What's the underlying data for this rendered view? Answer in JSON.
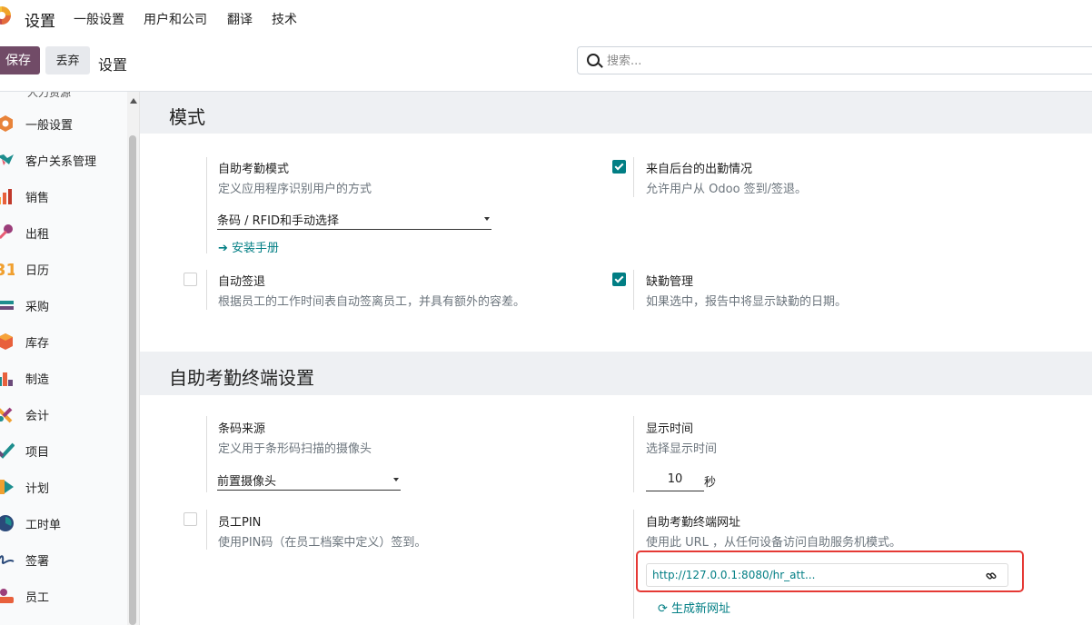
{
  "topbar": {
    "app_title": "设置",
    "menu": [
      "一般设置",
      "用户和公司",
      "翻译",
      "技术"
    ]
  },
  "toolbar": {
    "save_label": "保存",
    "discard_label": "丢弃",
    "breadcrumb": "设置",
    "search_placeholder": "搜索..."
  },
  "sidebar": {
    "cut_label": "人力资源",
    "items": [
      {
        "label": "一般设置",
        "icon": "general-settings-icon"
      },
      {
        "label": "客户关系管理",
        "icon": "crm-icon"
      },
      {
        "label": "销售",
        "icon": "sales-icon"
      },
      {
        "label": "出租",
        "icon": "rental-icon"
      },
      {
        "label": "日历",
        "icon": "calendar-icon"
      },
      {
        "label": "采购",
        "icon": "purchase-icon"
      },
      {
        "label": "库存",
        "icon": "inventory-icon"
      },
      {
        "label": "制造",
        "icon": "manufacturing-icon"
      },
      {
        "label": "会计",
        "icon": "accounting-icon"
      },
      {
        "label": "项目",
        "icon": "project-icon"
      },
      {
        "label": "计划",
        "icon": "planning-icon"
      },
      {
        "label": "工时单",
        "icon": "timesheet-icon"
      },
      {
        "label": "签署",
        "icon": "sign-icon"
      },
      {
        "label": "员工",
        "icon": "employees-icon"
      }
    ]
  },
  "modes": {
    "header": "模式",
    "kiosk_mode": {
      "title": "自助考勤模式",
      "desc": "定义应用程序识别用户的方式",
      "select_value": "条码 / RFID和手动选择",
      "link": "安装手册"
    },
    "backend_attendance": {
      "title": "来自后台的出勤情况",
      "desc": "允许用户从 Odoo 签到/签退。",
      "checked": true
    },
    "auto_checkout": {
      "title": "自动签退",
      "desc": "根据员工的工作时间表自动签离员工，并具有额外的容差。",
      "checked": false
    },
    "absence": {
      "title": "缺勤管理",
      "desc": "如果选中，报告中将显示缺勤的日期。",
      "checked": true
    }
  },
  "kiosk": {
    "header": "自助考勤终端设置",
    "barcode_source": {
      "title": "条码来源",
      "desc": "定义用于条形码扫描的摄像头",
      "select_value": "前置摄像头"
    },
    "display_time": {
      "title": "显示时间",
      "desc": "选择显示时间",
      "value": "10",
      "unit": "秒"
    },
    "employee_pin": {
      "title": "员工PIN",
      "desc": "使用PIN码（在员工档案中定义）签到。",
      "checked": false
    },
    "kiosk_url": {
      "title": "自助考勤终端网址",
      "desc": "使用此 URL ，从任何设备访问自助服务机模式。",
      "url": "http://127.0.0.1:8080/hr_att...",
      "regen_label": "生成新网址"
    }
  },
  "colors": {
    "brand": "#714b67",
    "accent": "#017e84",
    "highlight": "#e53935"
  }
}
